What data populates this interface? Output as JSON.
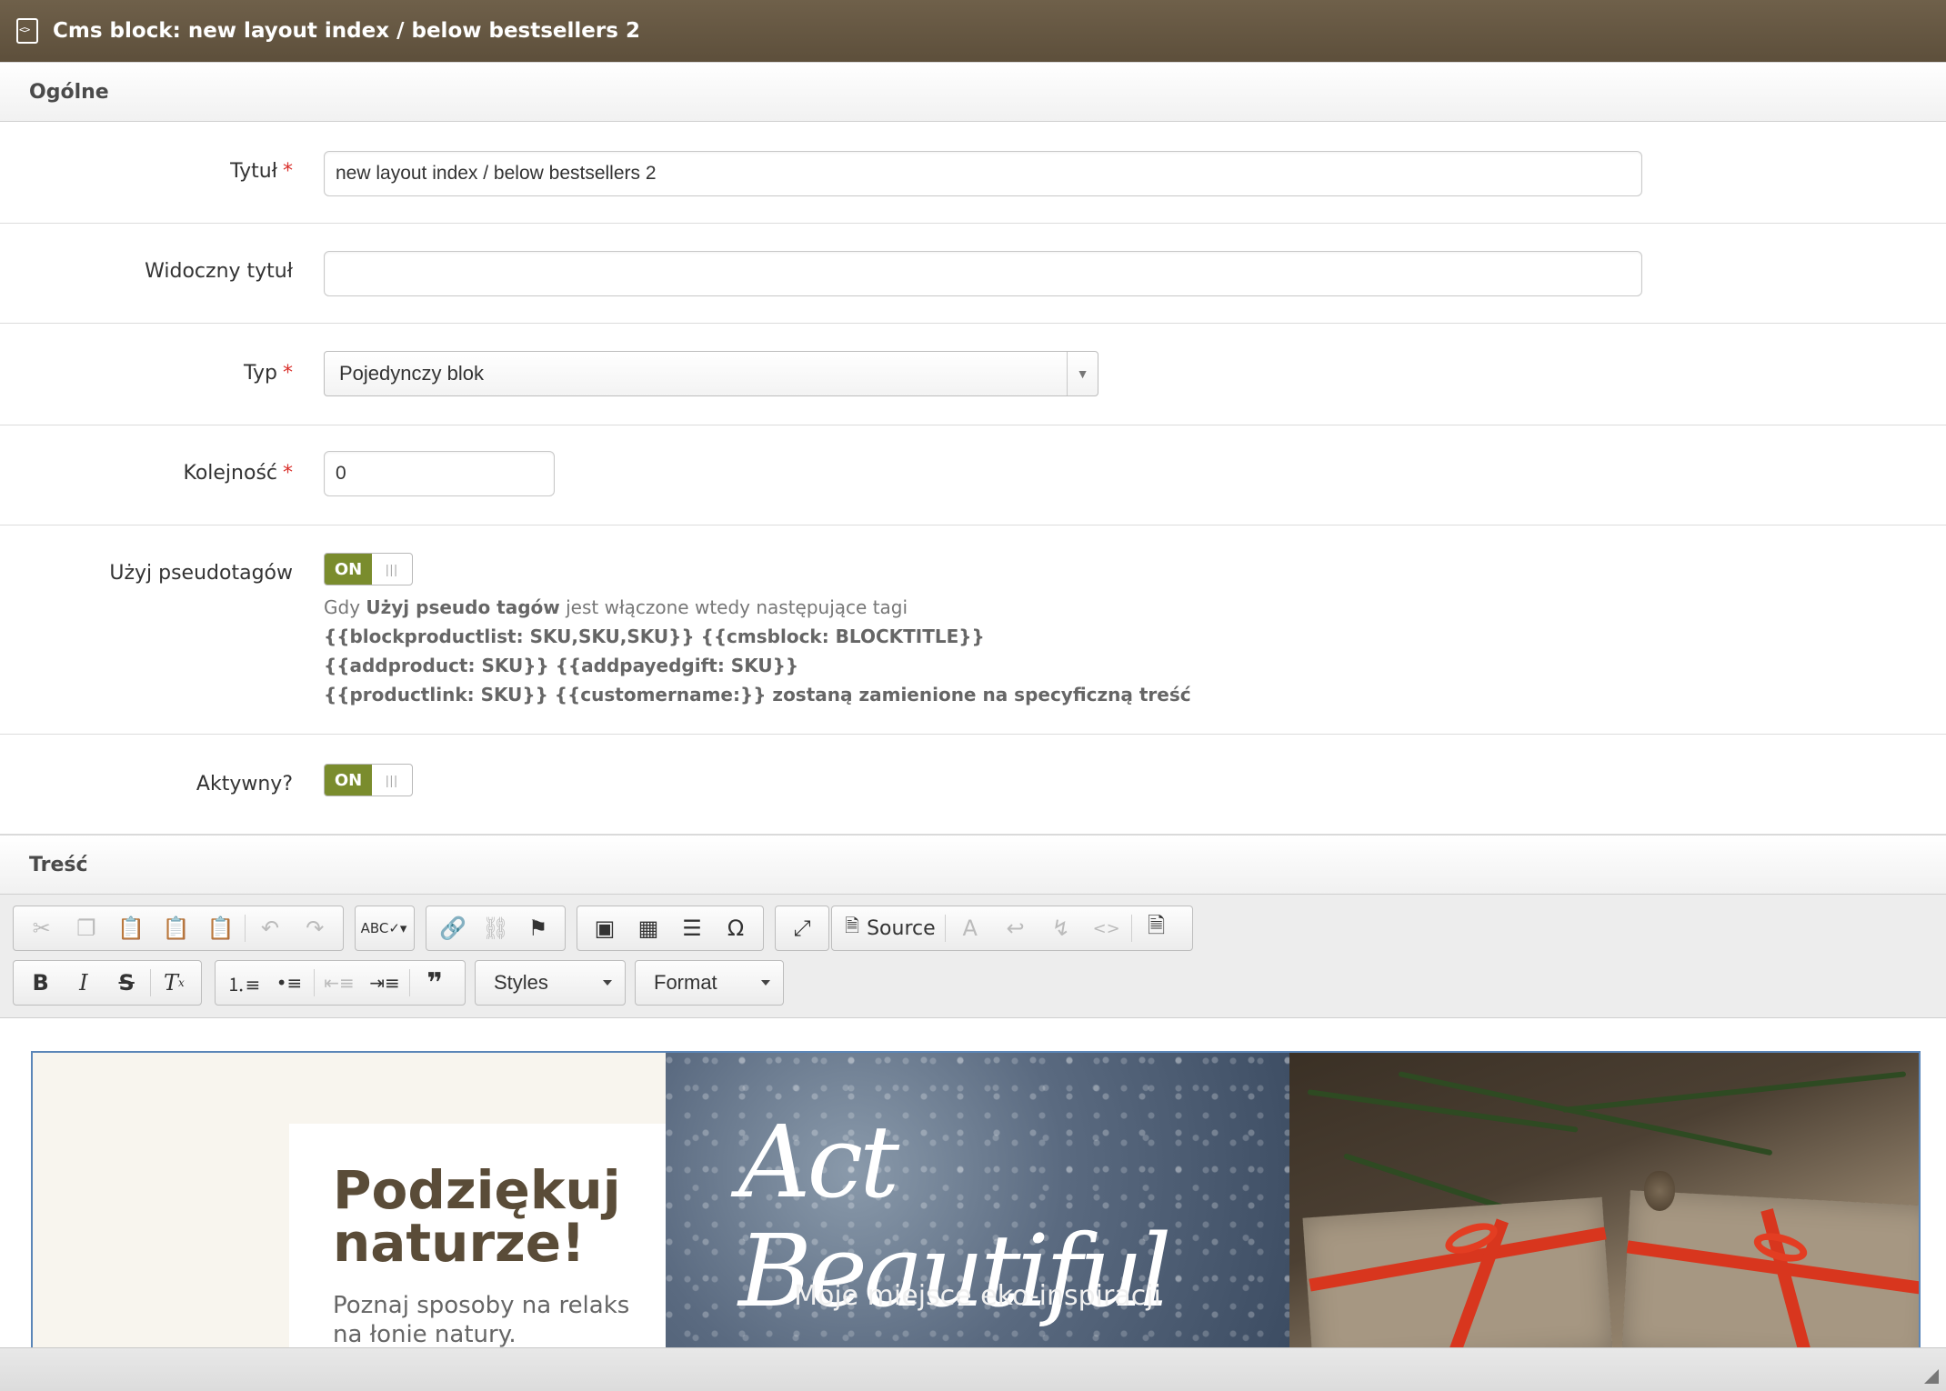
{
  "window": {
    "title": "Cms block: new layout index / below bestsellers 2"
  },
  "sections": {
    "general": "Ogólne",
    "content": "Treść"
  },
  "form": {
    "title": {
      "label": "Tytuł",
      "required": "*",
      "value": "new layout index / below bestsellers 2"
    },
    "visible_title": {
      "label": "Widoczny tytuł",
      "value": ""
    },
    "type": {
      "label": "Typ",
      "required": "*",
      "value": "Pojedynczy blok"
    },
    "order": {
      "label": "Kolejność",
      "required": "*",
      "value": "0"
    },
    "pseudotags": {
      "label": "Użyj pseudotagów",
      "toggle": "ON",
      "help_prefix": "Gdy ",
      "help_bold": "Użyj pseudo tagów",
      "help_suffix": " jest włączone wtedy następujące tagi",
      "line2": "{{blockproductlist: SKU,SKU,SKU}} {{cmsblock: BLOCKTITLE}}",
      "line3": "{{addproduct: SKU}} {{addpayedgift: SKU}}",
      "line4": "{{productlink: SKU}} {{customername:}} zostaną zamienione na specyficzną treść"
    },
    "active": {
      "label": "Aktywny?",
      "toggle": "ON"
    }
  },
  "editor": {
    "toolbar": {
      "source_label": "Source",
      "styles_label": "Styles",
      "format_label": "Format"
    },
    "banner": {
      "headline_line1": "Podziękuj",
      "headline_line2": "naturze!",
      "sub": "Poznaj sposoby na relaks na łonie natury.",
      "script": "Act Beautiful",
      "tagline": "Moje miejsce eko-inspiracji"
    }
  }
}
